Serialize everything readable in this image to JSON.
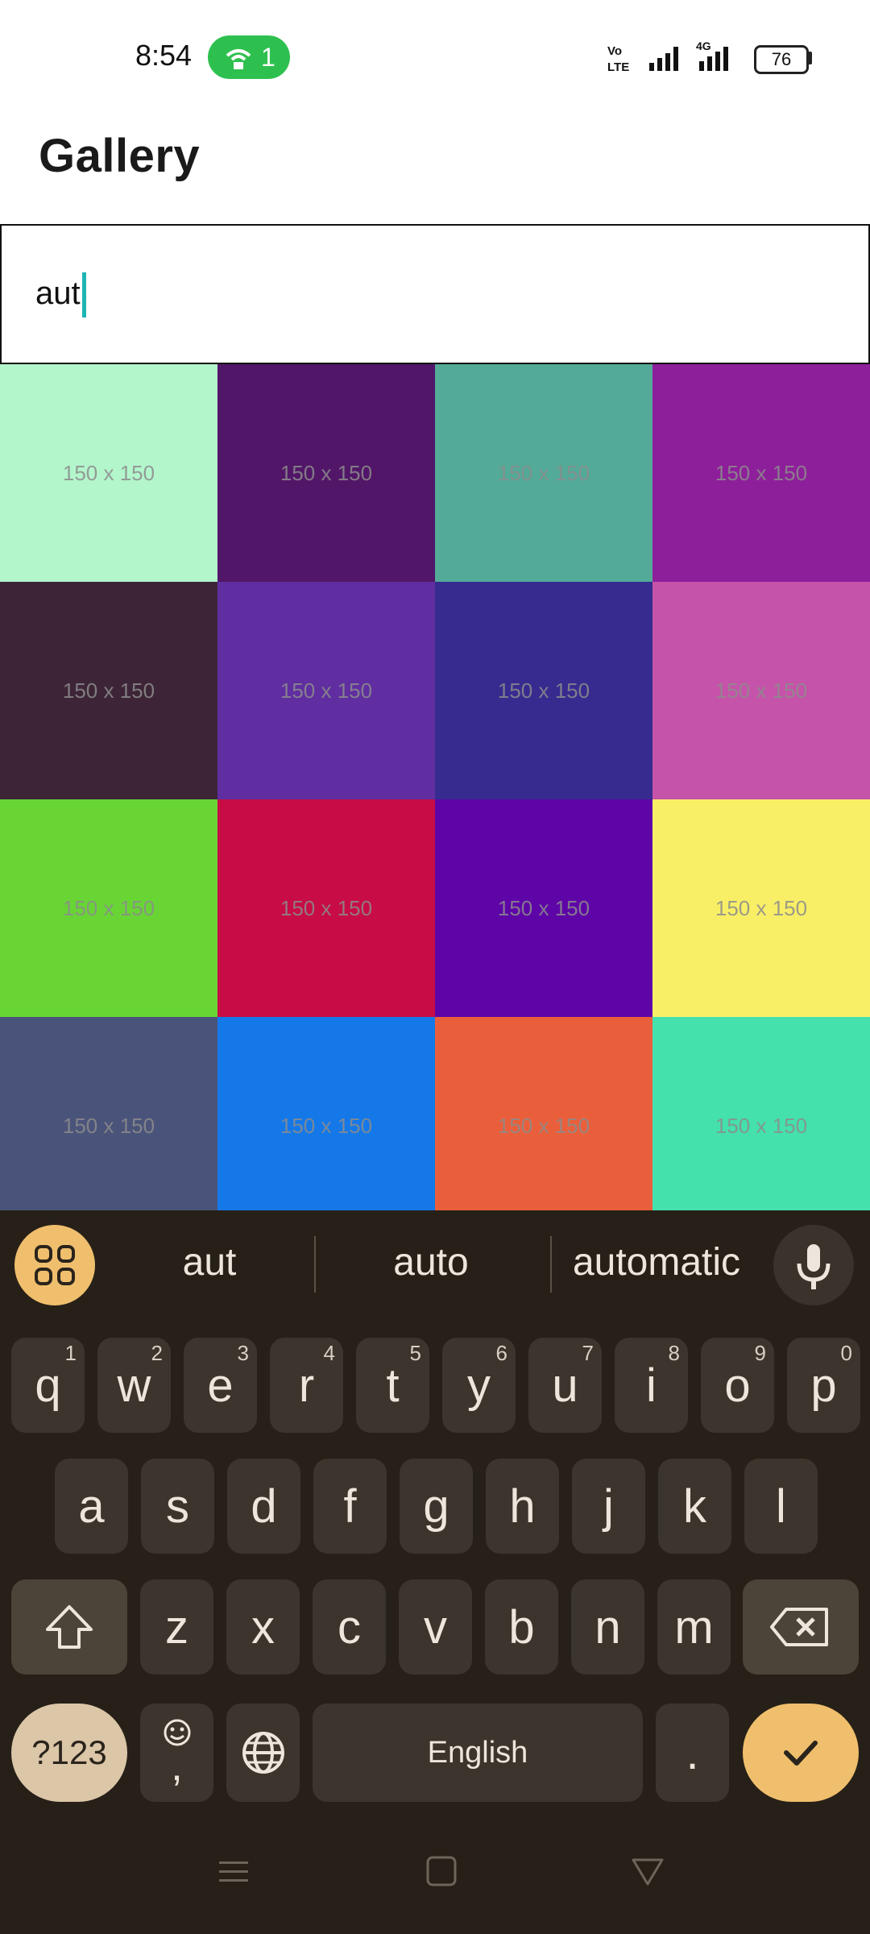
{
  "status": {
    "time": "8:54",
    "hotspot_count": "1",
    "battery": "76",
    "network": "4G"
  },
  "header": {
    "title": "Gallery"
  },
  "search": {
    "value": "aut"
  },
  "gallery": {
    "placeholder_label": "150 x 150",
    "tiles": [
      {
        "color": "#b3f6cc",
        "label": "150 x 150"
      },
      {
        "color": "#521669",
        "label": "150 x 150"
      },
      {
        "color": "#53aa98",
        "label": "150 x 150"
      },
      {
        "color": "#8e1f9a",
        "label": "150 x 150"
      },
      {
        "color": "#3d2537",
        "label": "150 x 150"
      },
      {
        "color": "#602ea0",
        "label": "150 x 150"
      },
      {
        "color": "#372b90",
        "label": "150 x 150"
      },
      {
        "color": "#c553a9",
        "label": "150 x 150"
      },
      {
        "color": "#68d535",
        "label": "150 x 150"
      },
      {
        "color": "#c70c46",
        "label": "150 x 150"
      },
      {
        "color": "#5e05a8",
        "label": "150 x 150"
      },
      {
        "color": "#f9ef67",
        "label": "150 x 150"
      },
      {
        "color": "#4a547a",
        "label": "150 x 150"
      },
      {
        "color": "#1578e8",
        "label": "150 x 150"
      },
      {
        "color": "#ea5f3b",
        "label": "150 x 150"
      },
      {
        "color": "#44e1ad",
        "label": "150 x 150"
      }
    ]
  },
  "keyboard": {
    "suggestions": [
      "aut",
      "auto",
      "automatic"
    ],
    "row1": [
      {
        "k": "q",
        "h": "1"
      },
      {
        "k": "w",
        "h": "2"
      },
      {
        "k": "e",
        "h": "3"
      },
      {
        "k": "r",
        "h": "4"
      },
      {
        "k": "t",
        "h": "5"
      },
      {
        "k": "y",
        "h": "6"
      },
      {
        "k": "u",
        "h": "7"
      },
      {
        "k": "i",
        "h": "8"
      },
      {
        "k": "o",
        "h": "9"
      },
      {
        "k": "p",
        "h": "0"
      }
    ],
    "row2": [
      "a",
      "s",
      "d",
      "f",
      "g",
      "h",
      "j",
      "k",
      "l"
    ],
    "row3": [
      "z",
      "x",
      "c",
      "v",
      "b",
      "n",
      "m"
    ],
    "symbols_label": "?123",
    "comma_label": ",",
    "space_label": "English",
    "period_label": ".",
    "accent": "#f0bf6d"
  }
}
